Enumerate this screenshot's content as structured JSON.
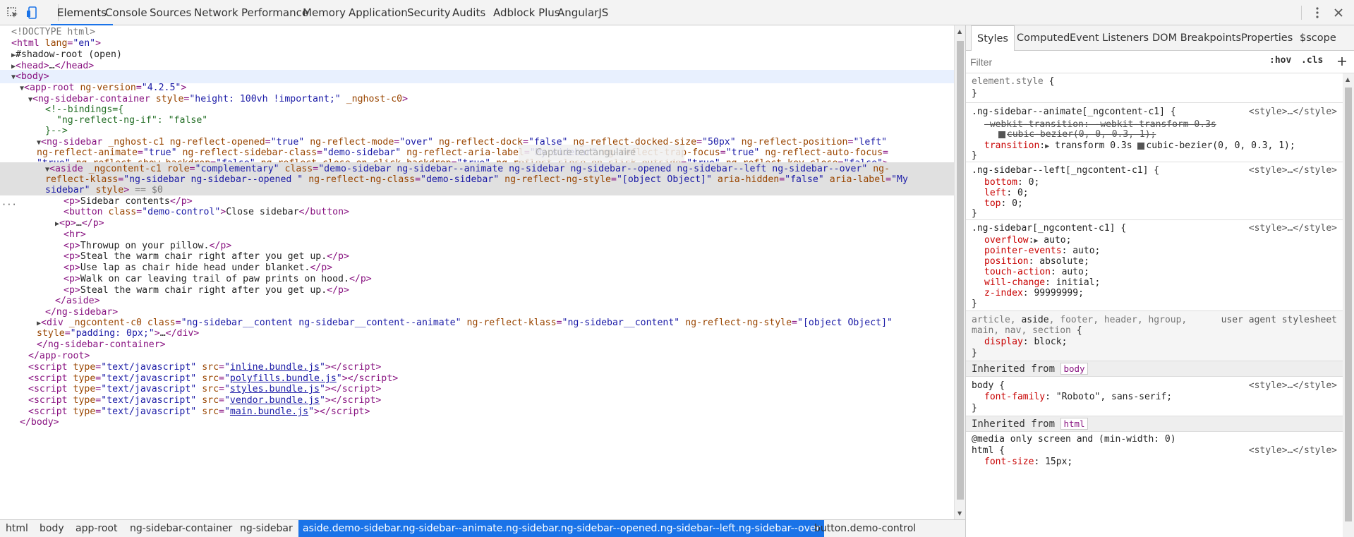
{
  "toolbar": {
    "tabs": [
      "Elements",
      "Console",
      "Sources",
      "Network",
      "Performance",
      "Memory",
      "Application",
      "Security",
      "Audits",
      "Adblock Plus",
      "AngularJS"
    ],
    "active_tab": "Elements"
  },
  "dom": {
    "doctype": "<!DOCTYPE html>",
    "selected_suffix": " == $0"
  },
  "breadcrumbs": [
    "html",
    "body",
    "app-root",
    "ng-sidebar-container",
    "ng-sidebar",
    "aside.demo-sidebar.ng-sidebar--animate.ng-sidebar.ng-sidebar--opened.ng-sidebar--left.ng-sidebar--over",
    "button.demo-control"
  ],
  "styles_panel": {
    "tabs": [
      "Styles",
      "Computed",
      "Event Listeners",
      "DOM Breakpoints",
      "Properties",
      "$scope"
    ],
    "filter_placeholder": "Filter",
    "hov": ":hov",
    "cls": ".cls",
    "ghost_tooltip": "Capture rectangulaire",
    "inherited_body": "Inherited from",
    "inherited_body_tag": "body",
    "inherited_html_tag": "html"
  },
  "colors": {
    "accent": "#1a73e8",
    "tag": "#881280",
    "attr_name": "#994500",
    "attr_value": "#1a1aa6",
    "comment": "#236e25",
    "css_prop": "#c80000"
  }
}
